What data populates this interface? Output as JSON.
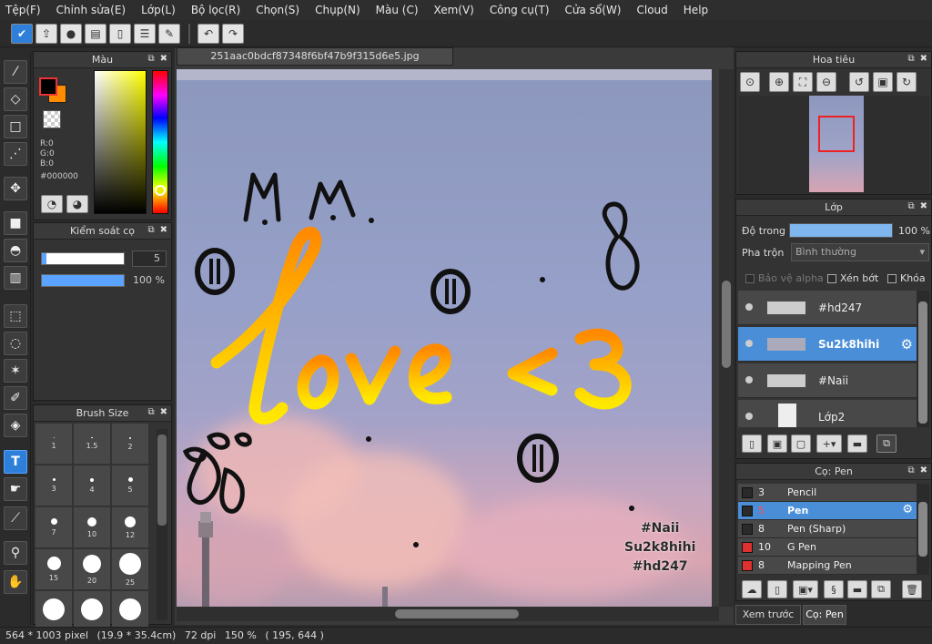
{
  "menu": [
    "Tệp(F)",
    "Chỉnh sửa(E)",
    "Lớp(L)",
    "Bộ lọc(R)",
    "Chọn(S)",
    "Chụp(N)",
    "Màu (C)",
    "Xem(V)",
    "Công cụ(T)",
    "Cửa sổ(W)",
    "Cloud",
    "Help"
  ],
  "toolbar": {
    "icons": [
      "check-icon",
      "share-icon",
      "speech-bubble-icon",
      "comment-icon",
      "document-icon",
      "list-icon",
      "edit-list-icon"
    ],
    "undo_icon": "undo-icon",
    "redo_icon": "redo-icon"
  },
  "tools": [
    "brush-icon",
    "eraser-icon",
    "rectangle-icon",
    "dot-line-icon",
    "move-icon",
    "fill-rect-icon",
    "bucket-icon",
    "gradient-icon",
    "rect-select-icon",
    "lasso-icon",
    "magic-wand-icon",
    "select-pen-icon",
    "select-eraser-icon",
    "text-icon",
    "hand-pointer-icon",
    "smudge-icon",
    "eyedropper-icon",
    "hand-icon"
  ],
  "color_panel": {
    "title": "Màu",
    "r": "R:0",
    "g": "G:0",
    "b": "B:0",
    "hex": "#000000",
    "fg_color": "#000000",
    "bg_color": "#ff8c00"
  },
  "brush_control": {
    "title": "Kiểm soát cọ",
    "size_value": "5",
    "size_fraction": 0.05,
    "opacity_value": "100 %"
  },
  "brush_size": {
    "title": "Brush Size",
    "sizes": [
      "1",
      "1.5",
      "2",
      "3",
      "4",
      "5",
      "7",
      "10",
      "12",
      "15",
      "20",
      "25",
      "",
      "",
      ""
    ]
  },
  "document": {
    "tab_title": "251aac0bdcf87348f6bf47b9f315d6e5.jpg",
    "tags": [
      "#Naii",
      "Su2k8hihi",
      "#hd247"
    ]
  },
  "navigator": {
    "title": "Hoa tiêu"
  },
  "layers": {
    "title": "Lớp",
    "opacity_label": "Độ trong",
    "opacity_value": "100 %",
    "blend_label": "Pha trộn",
    "blend_value": "Bình thường",
    "protect_alpha": "Bảo vệ alpha",
    "clipping": "Xén bớt",
    "lock": "Khóa",
    "items": [
      {
        "name": "#hd247",
        "selected": false
      },
      {
        "name": "Su2k8hihi",
        "selected": true
      },
      {
        "name": "#Naii",
        "selected": false
      },
      {
        "name": "Lớp2",
        "selected": false
      }
    ]
  },
  "brush_panel": {
    "title": "Cọ: Pen",
    "items": [
      {
        "size": "3",
        "name": "Pencil",
        "color": "#2a2a2a",
        "selected": false
      },
      {
        "size": "5",
        "name": "Pen",
        "color": "#2a2a2a",
        "selected": true
      },
      {
        "size": "8",
        "name": "Pen (Sharp)",
        "color": "#2a2a2a",
        "selected": false
      },
      {
        "size": "10",
        "name": "G Pen",
        "color": "#e03030",
        "selected": false
      },
      {
        "size": "8",
        "name": "Mapping Pen",
        "color": "#e03030",
        "selected": false
      }
    ]
  },
  "bottom_tabs": [
    "Xem trước cọ",
    "Cọ: Pen"
  ],
  "status": {
    "pixel_size": "564 * 1003 pixel",
    "cm_size": "(19.9 * 35.4cm)",
    "dpi": "72 dpi",
    "zoom": "150 %",
    "cursor": "( 195, 644 )"
  }
}
